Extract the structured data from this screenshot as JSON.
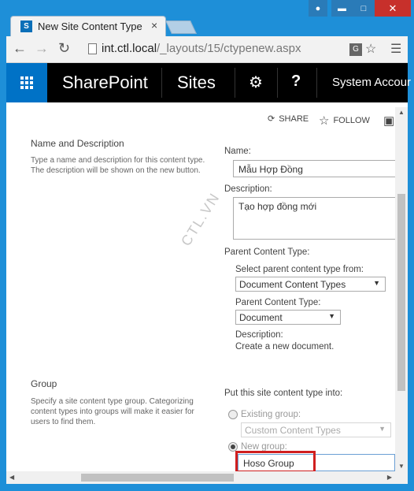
{
  "browser": {
    "tab_title": "New Site Content Type",
    "tab_icon_letter": "S",
    "url_host": "int.ctl.local",
    "url_path": "/_layouts/15/ctypenew.aspx"
  },
  "suitebar": {
    "brand": "SharePoint",
    "sites": "Sites",
    "user": "System Accour"
  },
  "actions": {
    "share": "SHARE",
    "follow": "FOLLOW"
  },
  "name_section": {
    "title": "Name and Description",
    "description": "Type a name and description for this content type. The description will be shown on the new button.",
    "name_label": "Name:",
    "name_value": "Mẫu Hợp Đồng",
    "description_label": "Description:",
    "description_value": "Tạo hợp đồng mới",
    "parent_label": "Parent Content Type:",
    "select_from_label": "Select parent content type from:",
    "select_from_value": "Document Content Types",
    "parent_type_label": "Parent Content Type:",
    "parent_type_value": "Document",
    "parent_desc_label": "Description:",
    "parent_desc_value": "Create a new document."
  },
  "group_section": {
    "title": "Group",
    "description": "Specify a site content type group. Categorizing content types into groups will make it easier for users to find them.",
    "put_into_label": "Put this site content type into:",
    "existing_label": "Existing group:",
    "existing_value": "Custom Content Types",
    "new_label": "New group:",
    "new_value": "Hoso Group"
  },
  "watermark": "CTL.VN",
  "colors": {
    "chrome": "#1e8fd8",
    "suitebar": "#000000",
    "waffle": "#0072c6",
    "highlight": "#d01f1f"
  }
}
